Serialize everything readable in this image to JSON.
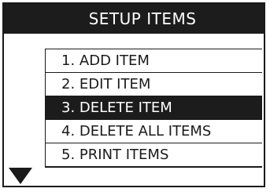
{
  "title": "SETUP ITEMS",
  "menu": {
    "items": [
      {
        "label": "1. ADD ITEM"
      },
      {
        "label": "2. EDIT ITEM"
      },
      {
        "label": "3. DELETE ITEM"
      },
      {
        "label": "4. DELETE ALL ITEMS"
      },
      {
        "label": "5. PRINT ITEMS"
      }
    ],
    "selected_index": 2
  },
  "scroll_indicator": "down-arrow-icon",
  "colors": {
    "title_background": "#1c1c1c",
    "title_text": "#ffffff",
    "selected_background": "#1c1c1c",
    "selected_text": "#ffffff",
    "text": "#1a1a1a"
  }
}
